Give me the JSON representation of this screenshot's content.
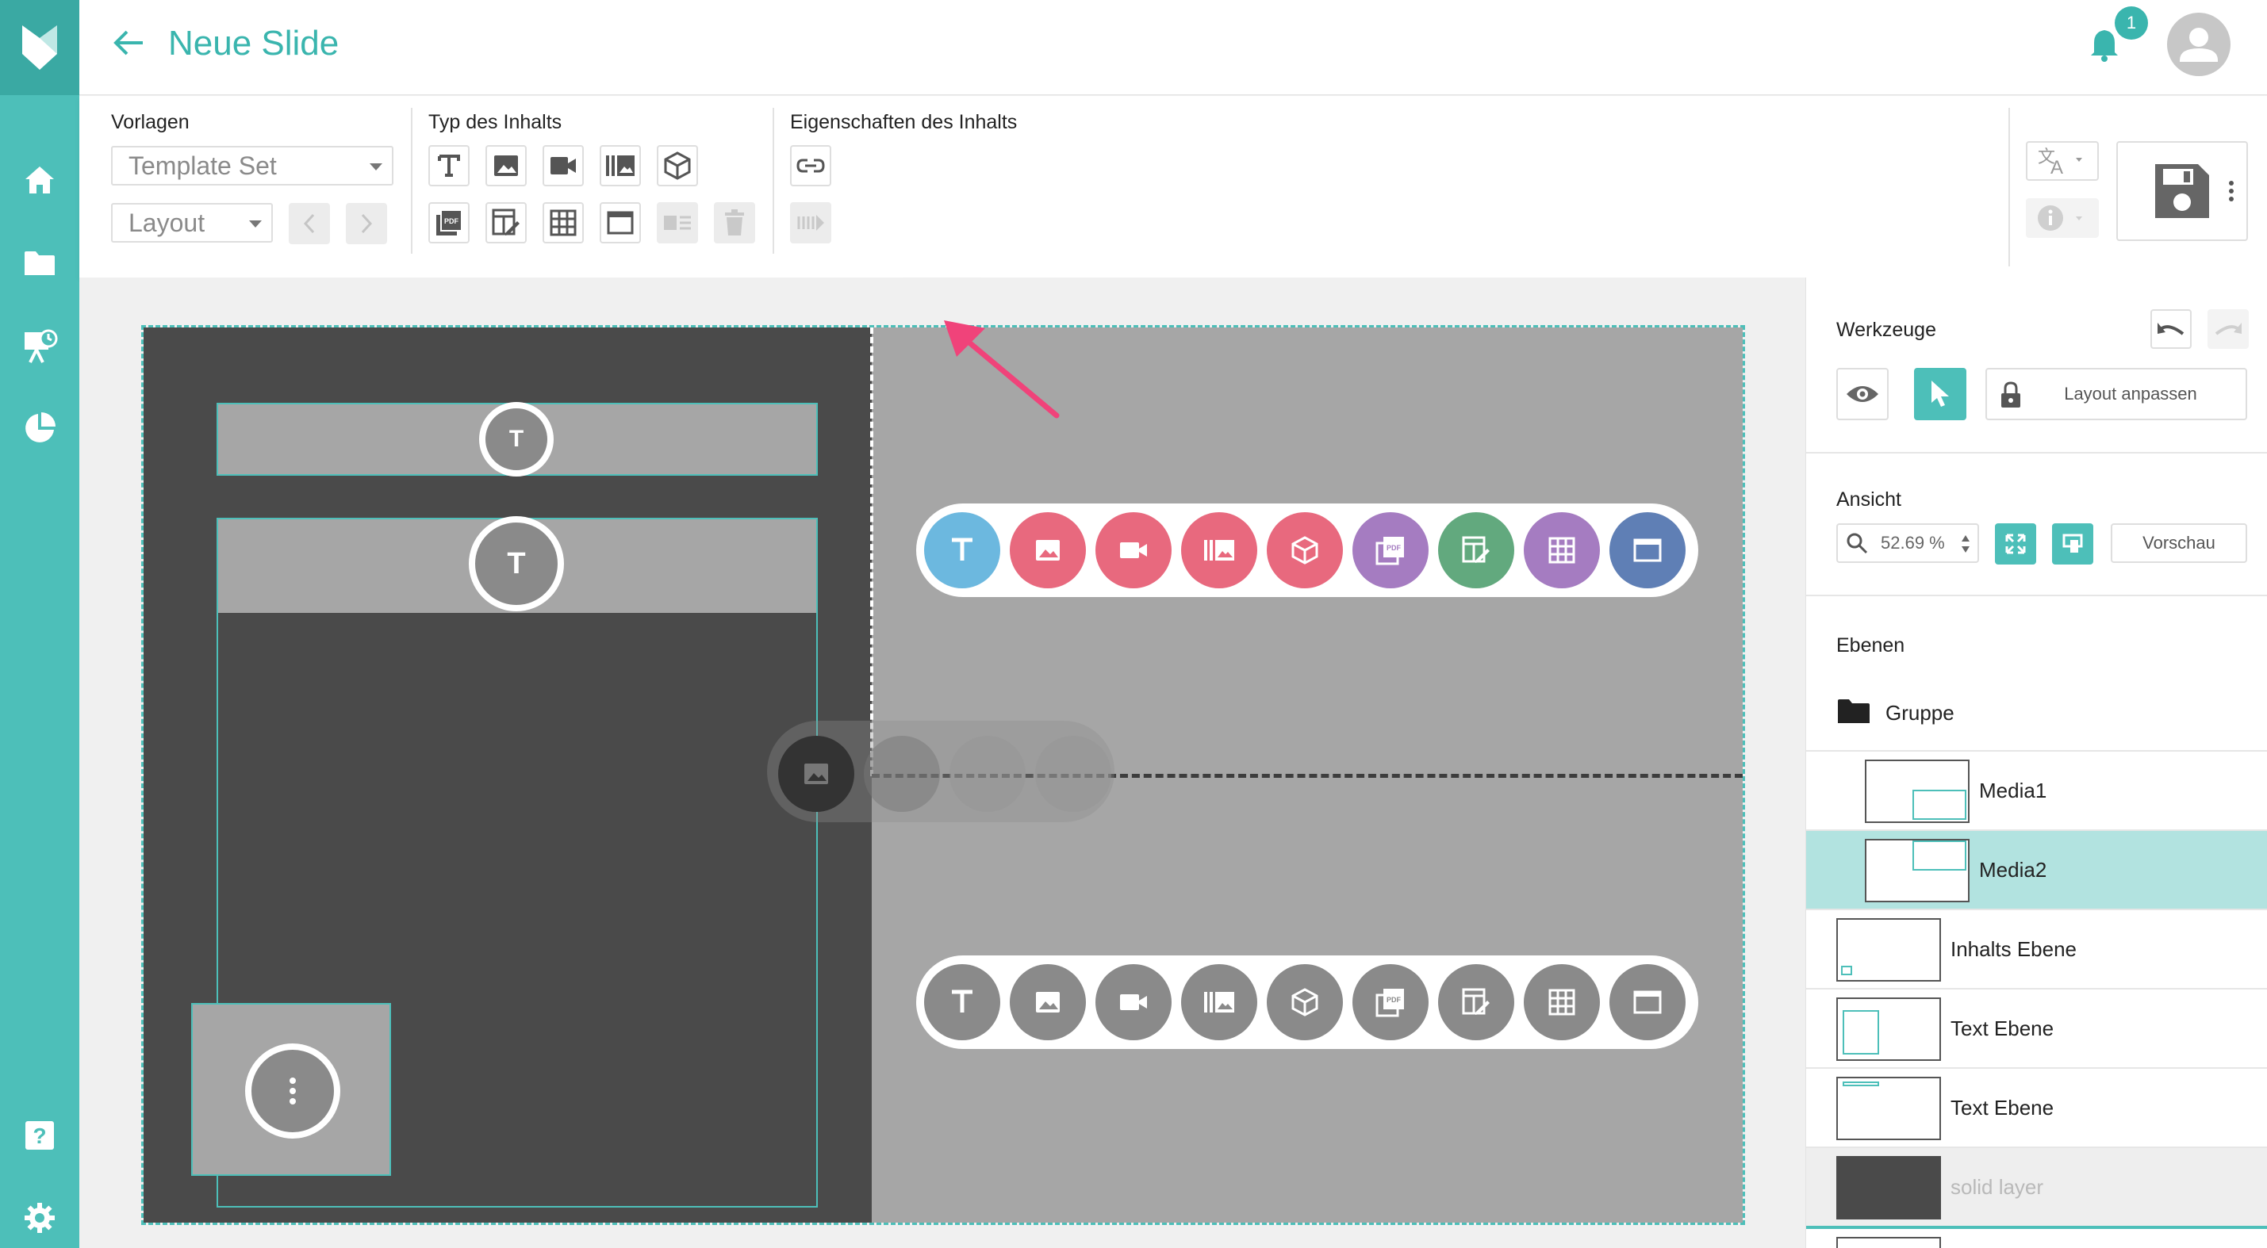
{
  "header": {
    "title": "Neue Slide",
    "notification_count": "1"
  },
  "toolbar": {
    "vorlagen_label": "Vorlagen",
    "template_select": "Template Set",
    "layout_select": "Layout",
    "typ_label": "Typ des Inhalts",
    "eigenschaften_label": "Eigenschaften des Inhalts"
  },
  "canvas": {
    "placeholder_icon_text": "T",
    "content_type_buttons": [
      {
        "name": "text",
        "label": "T",
        "color": "#6cb8df"
      },
      {
        "name": "image",
        "color": "#e8697e"
      },
      {
        "name": "video",
        "color": "#e8697e"
      },
      {
        "name": "gallery",
        "color": "#e8697e"
      },
      {
        "name": "3d",
        "color": "#e8697e"
      },
      {
        "name": "pdf",
        "color": "#a57cc1"
      },
      {
        "name": "form",
        "color": "#62a97e"
      },
      {
        "name": "table",
        "color": "#a57cc1"
      },
      {
        "name": "window",
        "color": "#5f7fb5"
      }
    ]
  },
  "right_panel": {
    "werkzeuge_label": "Werkzeuge",
    "layout_anpassen": "Layout anpassen",
    "ansicht_label": "Ansicht",
    "zoom_value": "52.69 %",
    "vorschau": "Vorschau",
    "ebenen_label": "Ebenen",
    "group_name": "Gruppe",
    "layers": [
      {
        "name": "Media1"
      },
      {
        "name": "Media2"
      },
      {
        "name": "Inhalts Ebene"
      },
      {
        "name": "Text Ebene"
      },
      {
        "name": "Text Ebene"
      },
      {
        "name": "solid layer"
      }
    ]
  },
  "colors": {
    "accent": "#4dbfb9",
    "accent_text": "#3ab5ae",
    "selected_layer": "#b2e3e0",
    "annotation_arrow": "#f0437a"
  }
}
